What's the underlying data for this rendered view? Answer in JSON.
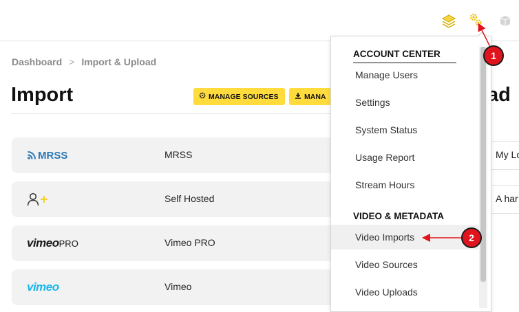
{
  "topbar": {
    "icons": [
      "layers-icon",
      "gears-icon",
      "box-icon"
    ]
  },
  "breadcrumb": {
    "items": [
      "Dashboard",
      "Import & Upload"
    ],
    "separator": ">"
  },
  "page": {
    "title": "Import",
    "buttons": {
      "manage_sources": "MANAGE SOURCES",
      "manage_2": "MANA"
    },
    "right_title_fragment": "ad"
  },
  "sources": [
    {
      "logo": "MRSS",
      "name": "MRSS"
    },
    {
      "logo": "",
      "name": "Self Hosted"
    },
    {
      "logo": "vimeo",
      "logo_suffix": "PRO",
      "name": "Vimeo PRO"
    },
    {
      "logo": "vimeo",
      "name": "Vimeo"
    }
  ],
  "side_cards": [
    "My Lo",
    "A har"
  ],
  "menu": {
    "section1": "ACCOUNT CENTER",
    "section1_items": [
      "Manage Users",
      "Settings",
      "System Status",
      "Usage Report",
      "Stream Hours"
    ],
    "section2": "VIDEO & METADATA",
    "section2_items": [
      "Video Imports",
      "Video Sources",
      "Video Uploads"
    ],
    "active_item": "Video Imports"
  },
  "annotations": {
    "marker1": "1",
    "marker2": "2",
    "color": "#e0141e"
  },
  "colors": {
    "accent_yellow": "#ffdb3e",
    "mrss_blue": "#2a77b4",
    "vimeo_blue": "#1ab7ea"
  }
}
